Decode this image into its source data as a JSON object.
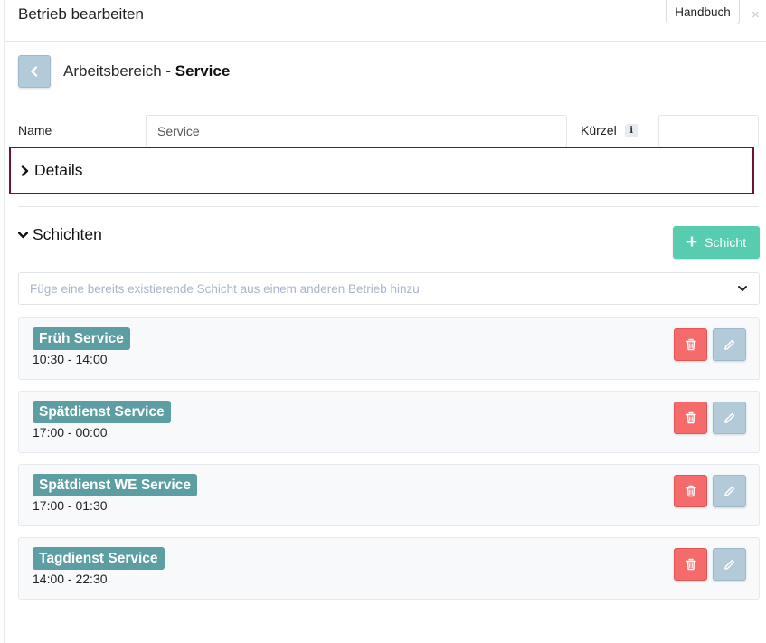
{
  "header": {
    "title": "Betrieb bearbeiten",
    "manual_label": "Handbuch",
    "close_glyph": "×"
  },
  "breadcrumb": {
    "prefix": "Arbeitsbereich - ",
    "name": "Service"
  },
  "form": {
    "name_label": "Name",
    "name_value": "Service",
    "short_label": "Kürzel",
    "short_value": ""
  },
  "details": {
    "title": "Details",
    "expanded": false
  },
  "shifts": {
    "title": "Schichten",
    "add_label": "Schicht",
    "select_placeholder": "Füge eine bereits existierende Schicht aus einem anderen Betrieb hinzu",
    "items": [
      {
        "name": "Früh Service",
        "time": "10:30 - 14:00"
      },
      {
        "name": "Spätdienst Service",
        "time": "17:00 - 00:00"
      },
      {
        "name": "Spätdienst WE Service",
        "time": "17:00 - 01:30"
      },
      {
        "name": "Tagdienst Service",
        "time": "14:00 - 22:30"
      }
    ]
  },
  "icons": {
    "back": "chevron-left-icon",
    "info": "info-icon",
    "collapsed": "chevron-right-icon",
    "expanded": "chevron-down-icon",
    "add": "plus-icon",
    "select": "chevron-down-icon",
    "delete": "trash-icon",
    "edit": "pencil-icon"
  },
  "colors": {
    "accent_green": "#57ccae",
    "badge_teal": "#5d9ea2",
    "delete_red": "#f56b6b",
    "edit_blue": "#b3cad9",
    "highlight_border": "#6e1431"
  }
}
